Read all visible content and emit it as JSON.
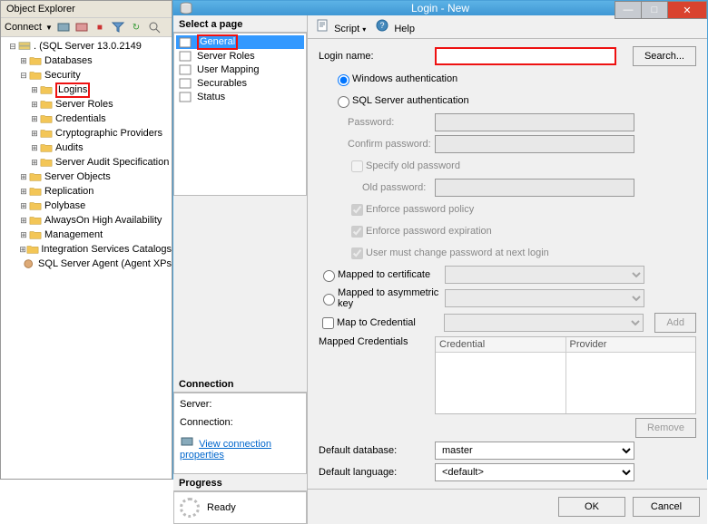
{
  "objexp": {
    "title": "Object Explorer",
    "connect_label": "Connect",
    "root": ". (SQL Server 13.0.2149",
    "nodes": {
      "databases": "Databases",
      "security": "Security",
      "logins": "Logins",
      "server_roles": "Server Roles",
      "credentials": "Credentials",
      "crypto_providers": "Cryptographic Providers",
      "audits": "Audits",
      "server_audit_spec": "Server Audit Specification",
      "server_objects": "Server Objects",
      "replication": "Replication",
      "polybase": "Polybase",
      "alwayson": "AlwaysOn High Availability",
      "management": "Management",
      "isc": "Integration Services Catalogs",
      "sql_agent": "SQL Server Agent (Agent XPs"
    }
  },
  "dialog": {
    "title": "Login - New",
    "select_page": "Select a page",
    "pages": {
      "general": "General",
      "server_roles": "Server Roles",
      "user_mapping": "User Mapping",
      "securables": "Securables",
      "status": "Status"
    },
    "toolbar": {
      "script": "Script",
      "help": "Help"
    },
    "form": {
      "login_name": "Login name:",
      "search": "Search...",
      "win_auth": "Windows authentication",
      "sql_auth": "SQL Server authentication",
      "password": "Password:",
      "confirm": "Confirm password:",
      "specify_old": "Specify old password",
      "old_password": "Old password:",
      "enf_policy": "Enforce password policy",
      "enf_expire": "Enforce password expiration",
      "must_change": "User must change password at next login",
      "mapped_cert": "Mapped to certificate",
      "mapped_asym": "Mapped to asymmetric key",
      "map_cred": "Map to Credential",
      "add": "Add",
      "mapped_creds": "Mapped Credentials",
      "col_cred": "Credential",
      "col_prov": "Provider",
      "remove": "Remove",
      "def_db": "Default database:",
      "def_db_val": "master",
      "def_lang": "Default language:",
      "def_lang_val": "<default>"
    },
    "connection": {
      "head": "Connection",
      "server": "Server:",
      "conn": "Connection:",
      "view_props": "View connection properties"
    },
    "progress": {
      "head": "Progress",
      "ready": "Ready"
    },
    "footer": {
      "ok": "OK",
      "cancel": "Cancel"
    }
  }
}
